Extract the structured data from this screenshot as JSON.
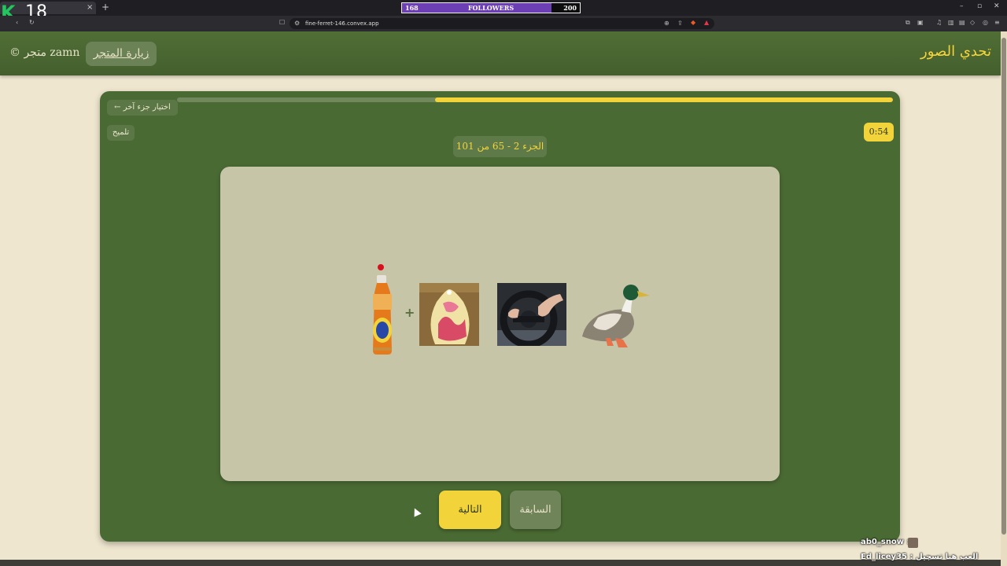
{
  "browser": {
    "tab_close": "×",
    "tab_new": "+",
    "url": "fine-ferret-146.convex.app",
    "window_controls": [
      "–",
      "▫",
      "✕"
    ]
  },
  "stream": {
    "logo_letter": "K",
    "viewer_count": "18",
    "followers": {
      "current": "168",
      "label": "FOLLOWERS",
      "goal": "200",
      "fill_fraction": 0.84
    },
    "chat": [
      {
        "user": "ab0_snow",
        "text": "ab0_snow :"
      },
      {
        "user": "Ed_licey35",
        "text": "Ed_licey35 : العب هنا تسجيل"
      }
    ]
  },
  "header": {
    "title": "تحدي الصور",
    "store_button": "زيارة المتجر",
    "copyright": "© متجر zamn"
  },
  "game": {
    "change_part_button": "← اختيار جزء آخر",
    "hint_button": "تلميح",
    "timer": "0:54",
    "part_label": "الجزء 2 - 65 من 101",
    "progress_fraction": 0.64,
    "plus": "+",
    "puzzle_images": [
      "juice-bottle",
      "colorful-bag",
      "steering-wheel",
      "duck"
    ],
    "next_button": "التالية",
    "prev_button": "السابقة"
  },
  "colors": {
    "accent": "#f2d33a",
    "card_green": "#4a6a33",
    "background": "#efe6cf"
  }
}
